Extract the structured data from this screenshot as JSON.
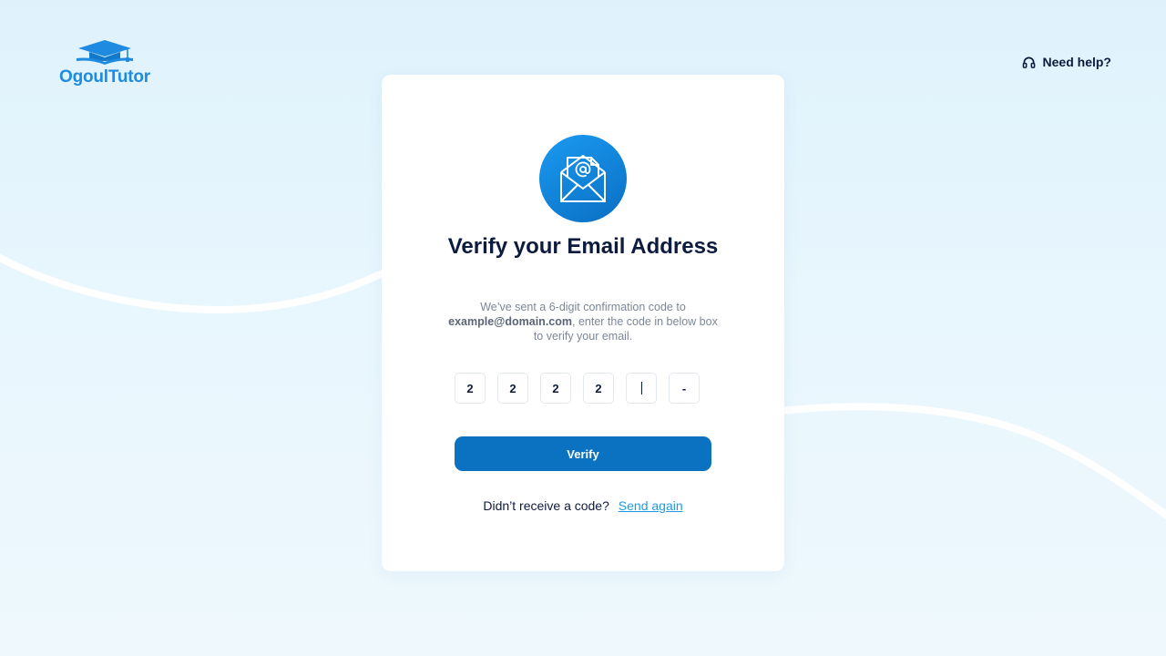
{
  "brand": {
    "name": "OgoulTutor",
    "color": "#1e8be0"
  },
  "header": {
    "help_label": "Need help?",
    "help_icon": "headphones-icon"
  },
  "card": {
    "icon": "email-at-envelope-icon",
    "title": "Verify your Email Address",
    "description_before": "We’ve sent a 6-digit confirmation code to",
    "email": "example@domain.com",
    "description_after": ", enter the code in below box to verify your email.",
    "code_digits": [
      "2",
      "2",
      "2",
      "2",
      "",
      "-"
    ],
    "verify_label": "Verify",
    "resend_prompt": "Didn’t receive a code?",
    "resend_link": "Send again"
  },
  "colors": {
    "accent": "#0a72c0",
    "link": "#1e9be0",
    "text_dark": "#0d1b3e",
    "text_muted": "#7d8797",
    "background": "#e4f4fc"
  }
}
